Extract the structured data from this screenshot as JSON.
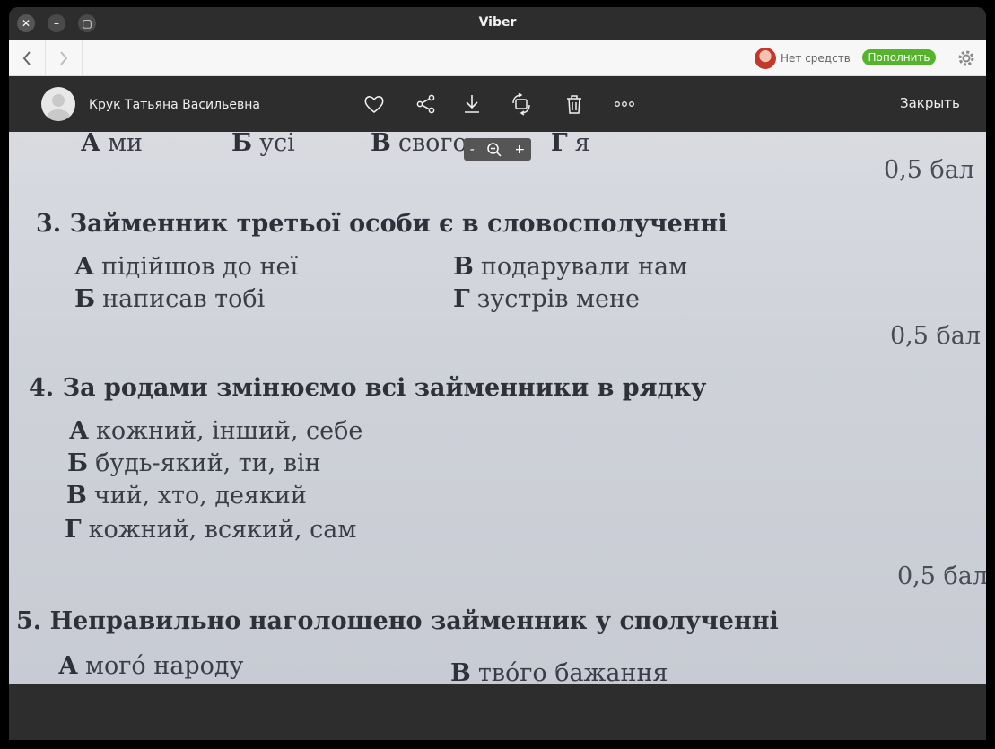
{
  "window": {
    "title": "Viber"
  },
  "nav": {
    "credit_text": "Нет средств",
    "topup_label": "Пополнить"
  },
  "viewer": {
    "sender_name": "Крук Татьяна Васильевна",
    "close_label": "Закрыть",
    "tools": [
      "heart-icon",
      "share-icon",
      "download-icon",
      "rotate-icon",
      "trash-icon",
      "more-icon"
    ]
  },
  "zoom": {
    "minus": "-",
    "plus": "+"
  },
  "photo": {
    "top_options": [
      {
        "letter": "А",
        "text": "ми"
      },
      {
        "letter": "Б",
        "text": "усі"
      },
      {
        "letter": "В",
        "text": "свого"
      },
      {
        "letter": "Г",
        "text": "я"
      }
    ],
    "points": "0,5 бал",
    "q3": {
      "number": "3.",
      "text": "Займенник третьої особи є в словосполученні",
      "options": [
        {
          "letter": "А",
          "text": "підійшов до неї"
        },
        {
          "letter": "В",
          "text": "подарували нам"
        },
        {
          "letter": "Б",
          "text": "написав тобі"
        },
        {
          "letter": "Г",
          "text": "зустрів мене"
        }
      ]
    },
    "q4": {
      "number": "4.",
      "text": "За родами змінюємо всі займенники в рядку",
      "options": [
        {
          "letter": "А",
          "text": "кожний, інший, себе"
        },
        {
          "letter": "Б",
          "text": "будь-який, ти, він"
        },
        {
          "letter": "В",
          "text": "чий, хто, деякий"
        },
        {
          "letter": "Г",
          "text": "кожний, всякий, сам"
        }
      ]
    },
    "q5": {
      "number": "5.",
      "text": "Неправильно наголошено займенник у сполученні",
      "options": [
        {
          "letter": "А",
          "text": "могó народу"
        },
        {
          "letter": "В",
          "text": "твóго бажання"
        }
      ]
    }
  }
}
